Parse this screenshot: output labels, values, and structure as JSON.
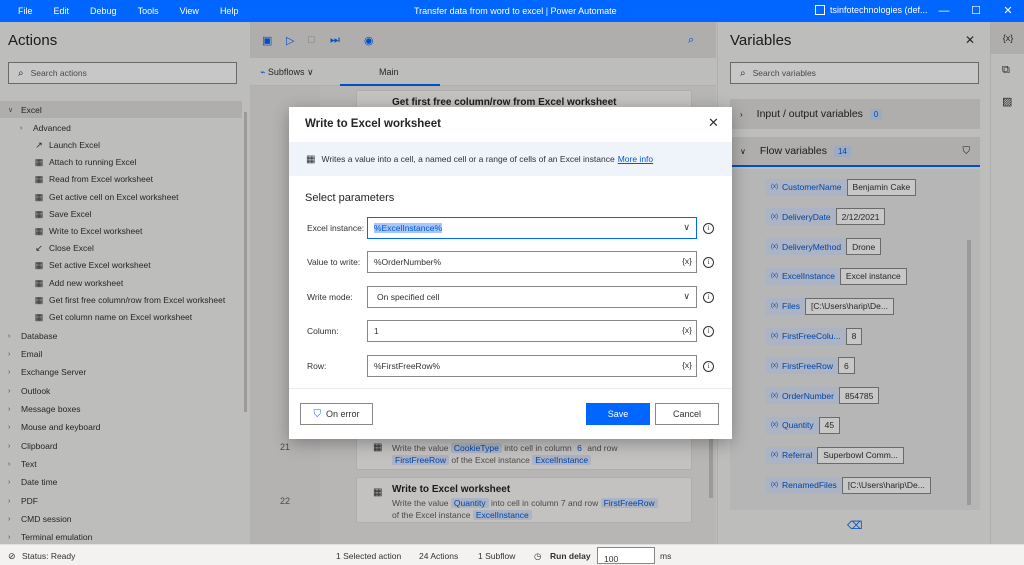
{
  "titlebar": {
    "menu": [
      "File",
      "Edit",
      "Debug",
      "Tools",
      "View",
      "Help"
    ],
    "title": "Transfer data from word to excel | Power Automate",
    "account": "tsinfotechnologies (def...",
    "controls": [
      "—",
      "☐",
      "✕"
    ]
  },
  "actions": {
    "title": "Actions",
    "search_placeholder": "Search actions",
    "excel_group": "Excel",
    "advanced_group": "Advanced",
    "excel_items": [
      {
        "label": "Launch Excel",
        "icon": "launch-icon"
      },
      {
        "label": "Attach to running Excel",
        "icon": "excel-icon"
      },
      {
        "label": "Read from Excel worksheet",
        "icon": "excel-icon"
      },
      {
        "label": "Get active cell on Excel worksheet",
        "icon": "excel-icon"
      },
      {
        "label": "Save Excel",
        "icon": "excel-icon"
      },
      {
        "label": "Write to Excel worksheet",
        "icon": "excel-icon"
      },
      {
        "label": "Close Excel",
        "icon": "close-excel-icon"
      },
      {
        "label": "Set active Excel worksheet",
        "icon": "excel-icon"
      },
      {
        "label": "Add new worksheet",
        "icon": "excel-icon"
      },
      {
        "label": "Get first free column/row from Excel worksheet",
        "icon": "excel-icon"
      },
      {
        "label": "Get column name on Excel worksheet",
        "icon": "excel-icon"
      }
    ],
    "groups": [
      "Database",
      "Email",
      "Exchange Server",
      "Outlook",
      "Message boxes",
      "Mouse and keyboard",
      "Clipboard",
      "Text",
      "Date time",
      "PDF",
      "CMD session",
      "Terminal emulation"
    ]
  },
  "center": {
    "tab_subflows": "Subflows",
    "tab_main": "Main",
    "top_step_title": "Get first free column/row from Excel worksheet",
    "line_21": "21",
    "line_22": "22",
    "step21": {
      "pre": "Write the value",
      "var1": "CookieType",
      "mid": "into cell in column",
      "col": "6",
      "mid2": "and row",
      "var2": "FirstFreeRow",
      "post": "of the Excel instance",
      "var3": "ExcelInstance"
    },
    "step22": {
      "title": "Write to Excel worksheet",
      "pre": "Write the value",
      "var1": "Quantity",
      "mid": "into cell in column 7 and row",
      "var2": "FirstFreeRow",
      "post": "of the Excel instance",
      "var3": "ExcelInstance"
    }
  },
  "variables": {
    "title": "Variables",
    "search_placeholder": "Search variables",
    "io_label": "Input / output variables",
    "io_count": "0",
    "flow_label": "Flow variables",
    "flow_count": "14",
    "items": [
      {
        "name": "CustomerName",
        "value": "Benjamin Cake"
      },
      {
        "name": "DeliveryDate",
        "value": "2/12/2021"
      },
      {
        "name": "DeliveryMethod",
        "value": "Drone"
      },
      {
        "name": "ExcelInstance",
        "value": "Excel instance"
      },
      {
        "name": "Files",
        "value": "[C:\\Users\\harip\\De..."
      },
      {
        "name": "FirstFreeColu...",
        "value": "8"
      },
      {
        "name": "FirstFreeRow",
        "value": "6"
      },
      {
        "name": "OrderNumber",
        "value": "854785"
      },
      {
        "name": "Quantity",
        "value": "45"
      },
      {
        "name": "Referral",
        "value": "Superbowl Comm..."
      },
      {
        "name": "RenamedFiles",
        "value": "[C:\\Users\\harip\\De..."
      }
    ]
  },
  "statusbar": {
    "status": "Status: Ready",
    "selected": "1 Selected action",
    "actions_count": "24 Actions",
    "subflow_count": "1 Subflow",
    "run_delay_label": "Run delay",
    "run_delay_value": "100",
    "unit": "ms"
  },
  "dialog": {
    "title": "Write to Excel worksheet",
    "description": "Writes a value into a cell, a named cell or a range of cells of an Excel instance",
    "more_info": "More info",
    "section": "Select parameters",
    "fields": {
      "excel_instance_label": "Excel instance:",
      "excel_instance_value": "%ExcelInstance%",
      "value_label": "Value to write:",
      "value_value": "%OrderNumber%",
      "mode_label": "Write mode:",
      "mode_value": "On specified cell",
      "column_label": "Column:",
      "column_value": "1",
      "row_label": "Row:",
      "row_value": "%FirstFreeRow%"
    },
    "var_button": "{x}",
    "on_error": "On error",
    "save": "Save",
    "cancel": "Cancel"
  }
}
